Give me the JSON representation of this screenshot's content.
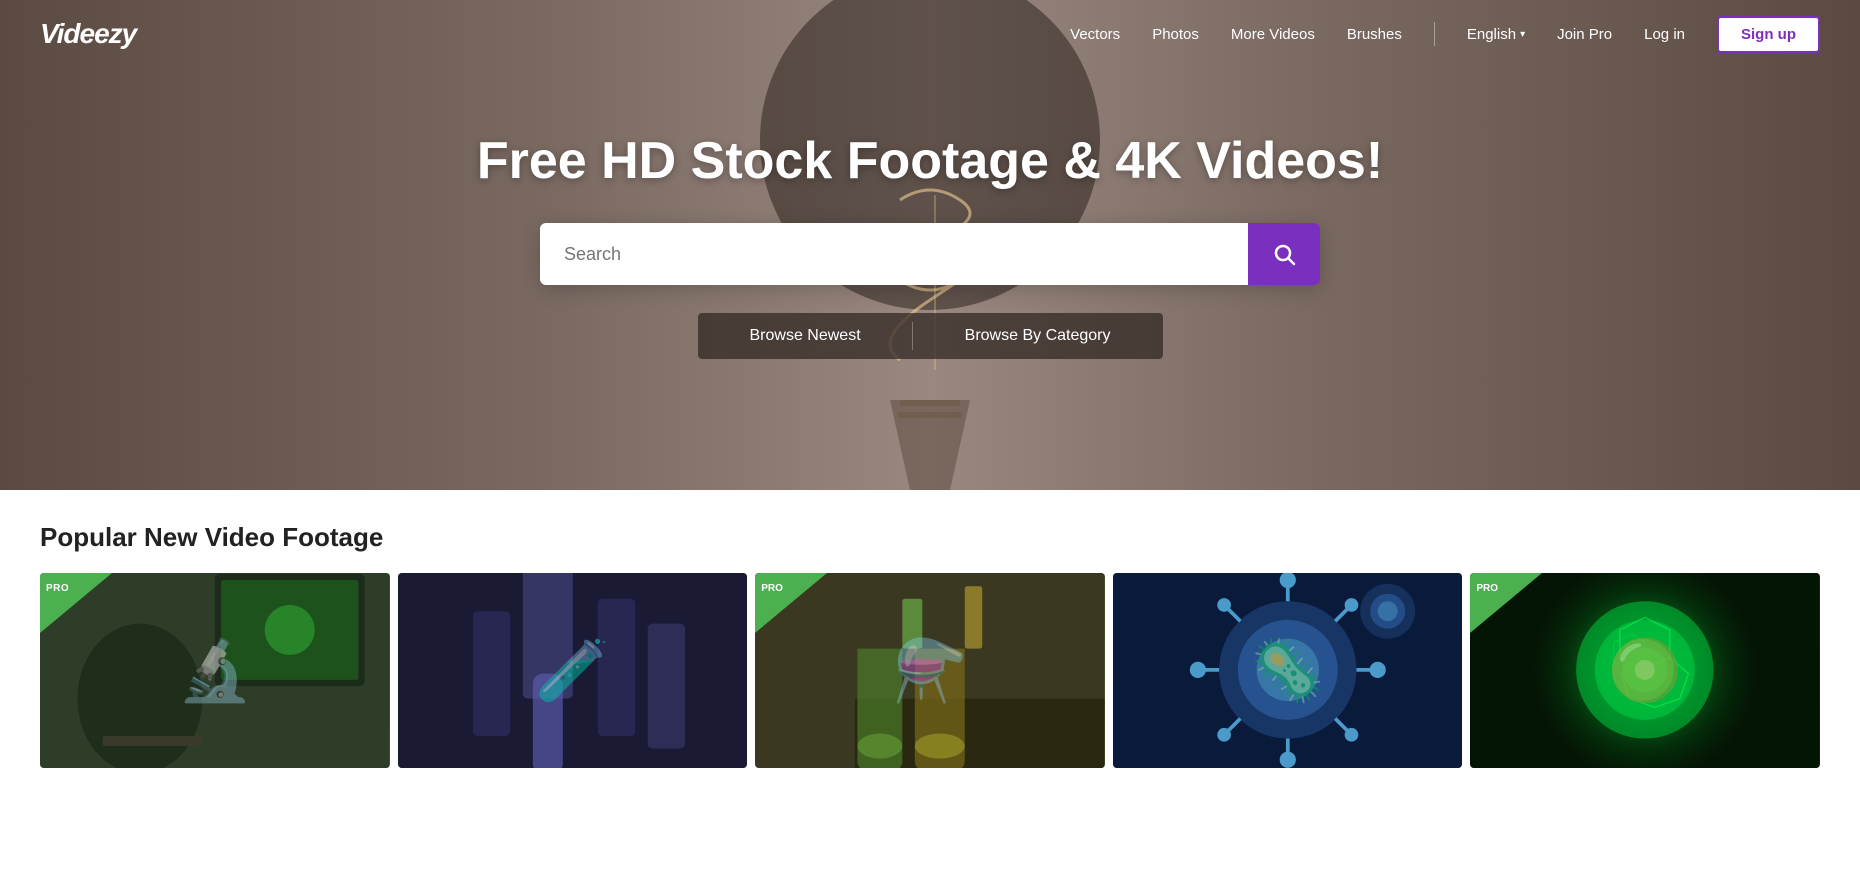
{
  "header": {
    "logo": "Videezy",
    "nav": {
      "vectors": "Vectors",
      "photos": "Photos",
      "more_videos": "More Videos",
      "brushes": "Brushes",
      "language": "English",
      "join_pro": "Join Pro",
      "log_in": "Log in",
      "sign_up": "Sign up"
    }
  },
  "hero": {
    "title": "Free HD Stock Footage & 4K Videos!",
    "search_placeholder": "Search",
    "browse_newest": "Browse Newest",
    "browse_by_category": "Browse By Category"
  },
  "popular": {
    "section_title": "Popular New Video Footage",
    "cards": [
      {
        "id": 1,
        "pro": true,
        "label": "Scientist at microscope"
      },
      {
        "id": 2,
        "pro": false,
        "label": "Lab pipette"
      },
      {
        "id": 3,
        "pro": true,
        "label": "Laboratory flasks"
      },
      {
        "id": 4,
        "pro": false,
        "label": "Virus cells blue"
      },
      {
        "id": 5,
        "pro": true,
        "label": "Green glowing cell"
      }
    ]
  },
  "icons": {
    "search": "🔍",
    "chevron_down": "▾"
  }
}
